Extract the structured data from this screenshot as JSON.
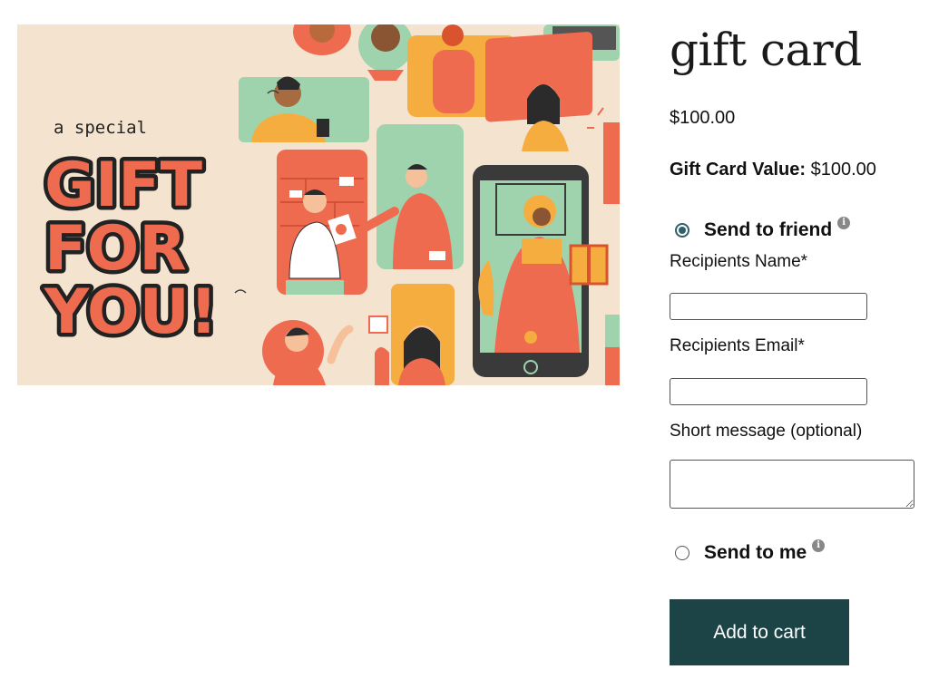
{
  "product": {
    "title": "gift card",
    "price": "$100.00",
    "value_label": "Gift Card Value:",
    "value_amount": "$100.00"
  },
  "hero": {
    "kicker": "a special",
    "headline_lines": [
      "GIFT",
      "FOR",
      "YOU!"
    ],
    "colors": {
      "background": "#f3e3cf",
      "coral": "#ef6b4f",
      "mint": "#9fd3ad",
      "orange": "#f6ad3f",
      "ink": "#222222"
    }
  },
  "delivery": {
    "send_to_friend_label": "Send to friend",
    "send_to_me_label": "Send to me",
    "selected": "send_to_friend",
    "info_glyph": "i",
    "recipient_name_label": "Recipients Name*",
    "recipient_name_value": "",
    "recipient_email_label": "Recipients Email*",
    "recipient_email_value": "",
    "message_label": "Short message (optional)",
    "message_value": ""
  },
  "actions": {
    "add_to_cart_label": "Add to cart"
  },
  "colors": {
    "accent": "#1c4447",
    "radio": "#2f5f6a"
  }
}
